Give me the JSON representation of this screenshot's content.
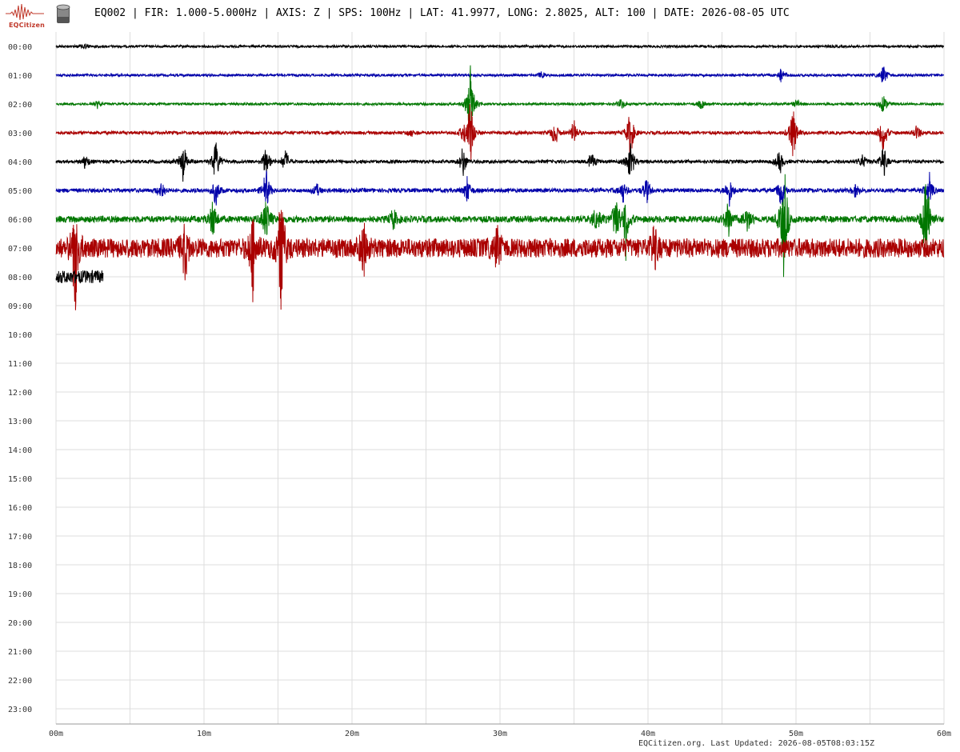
{
  "header": {
    "logo_text": "EQCitizen",
    "title": "EQ002 | FIR: 1.000-5.000Hz | AXIS: Z | SPS: 100Hz | LAT: 41.9977, LONG: 2.8025, ALT: 100 | DATE: 2026-08-05 UTC"
  },
  "footer": {
    "updated": "EQCitizen.org. Last Updated: 2026-08-05T08:03:15Z"
  },
  "icons": {
    "logo": "seismograph-logo-icon",
    "sensor": "sensor-icon"
  },
  "colors": {
    "grid": "#dddddd",
    "traces": [
      "#000000",
      "#0000aa",
      "#007700",
      "#aa0000"
    ]
  },
  "chart_data": {
    "type": "line",
    "title": "EQ002 | FIR: 1.000-5.000Hz | AXIS: Z | SPS: 100Hz | LAT: 41.9977, LONG: 2.8025, ALT: 100 | DATE: 2026-08-05 UTC",
    "xlabel": "",
    "ylabel": "",
    "x_ticks": [
      "00m",
      "10m",
      "20m",
      "30m",
      "40m",
      "50m",
      "60m"
    ],
    "y_ticks": [
      "00:00",
      "01:00",
      "02:00",
      "03:00",
      "04:00",
      "05:00",
      "06:00",
      "07:00",
      "08:00",
      "09:00",
      "10:00",
      "11:00",
      "12:00",
      "13:00",
      "14:00",
      "15:00",
      "16:00",
      "17:00",
      "18:00",
      "19:00",
      "20:00",
      "21:00",
      "22:00",
      "23:00"
    ],
    "xlim": [
      0,
      60
    ],
    "grid": true,
    "legend": "none",
    "rows": [
      {
        "hour": "00:00",
        "color": "#000000",
        "noise": 1.5,
        "end": 60,
        "events": [
          [
            1.9,
            6
          ]
        ]
      },
      {
        "hour": "01:00",
        "color": "#0000aa",
        "noise": 1.5,
        "end": 60,
        "events": [
          [
            32.8,
            5
          ],
          [
            49.0,
            12
          ],
          [
            55.9,
            16
          ]
        ]
      },
      {
        "hour": "02:00",
        "color": "#007700",
        "noise": 1.5,
        "end": 60,
        "events": [
          [
            2.8,
            5
          ],
          [
            28.0,
            60
          ],
          [
            38.2,
            8
          ],
          [
            43.6,
            7
          ],
          [
            50.1,
            7
          ],
          [
            55.9,
            16
          ]
        ]
      },
      {
        "hour": "03:00",
        "color": "#aa0000",
        "noise": 2,
        "end": 60,
        "events": [
          [
            24.0,
            6
          ],
          [
            27.5,
            10
          ],
          [
            28.0,
            55
          ],
          [
            33.7,
            22
          ],
          [
            35.0,
            18
          ],
          [
            38.8,
            35
          ],
          [
            49.8,
            42
          ],
          [
            55.9,
            34
          ],
          [
            58.2,
            12
          ]
        ]
      },
      {
        "hour": "04:00",
        "color": "#000000",
        "noise": 2,
        "end": 60,
        "events": [
          [
            2.0,
            10
          ],
          [
            8.6,
            28
          ],
          [
            10.8,
            35
          ],
          [
            14.2,
            25
          ],
          [
            15.5,
            18
          ],
          [
            27.5,
            22
          ],
          [
            36.2,
            16
          ],
          [
            38.8,
            35
          ],
          [
            48.9,
            18
          ],
          [
            54.5,
            12
          ],
          [
            55.9,
            25
          ]
        ]
      },
      {
        "hour": "05:00",
        "color": "#0000aa",
        "noise": 2.5,
        "end": 60,
        "events": [
          [
            7.1,
            14
          ],
          [
            10.8,
            22
          ],
          [
            14.2,
            30
          ],
          [
            17.6,
            10
          ],
          [
            27.8,
            20
          ],
          [
            38.3,
            16
          ],
          [
            39.9,
            20
          ],
          [
            45.5,
            22
          ],
          [
            49.0,
            30
          ],
          [
            54.0,
            10
          ],
          [
            59.0,
            25
          ]
        ]
      },
      {
        "hour": "06:00",
        "color": "#007700",
        "noise": 4,
        "end": 60,
        "events": [
          [
            10.6,
            30
          ],
          [
            14.2,
            40
          ],
          [
            22.8,
            15
          ],
          [
            36.5,
            20
          ],
          [
            37.8,
            28
          ],
          [
            38.5,
            45
          ],
          [
            45.4,
            28
          ],
          [
            46.7,
            18
          ],
          [
            49.2,
            90
          ],
          [
            58.8,
            90
          ]
        ]
      },
      {
        "hour": "07:00",
        "color": "#aa0000",
        "noise": 12,
        "end": 60,
        "events": [
          [
            1.3,
            90
          ],
          [
            8.7,
            40
          ],
          [
            13.3,
            60
          ],
          [
            15.2,
            90
          ],
          [
            20.8,
            30
          ],
          [
            29.8,
            30
          ],
          [
            40.4,
            30
          ]
        ]
      },
      {
        "hour": "08:00",
        "color": "#000000",
        "noise": 8,
        "end": 3.2,
        "events": []
      }
    ]
  }
}
